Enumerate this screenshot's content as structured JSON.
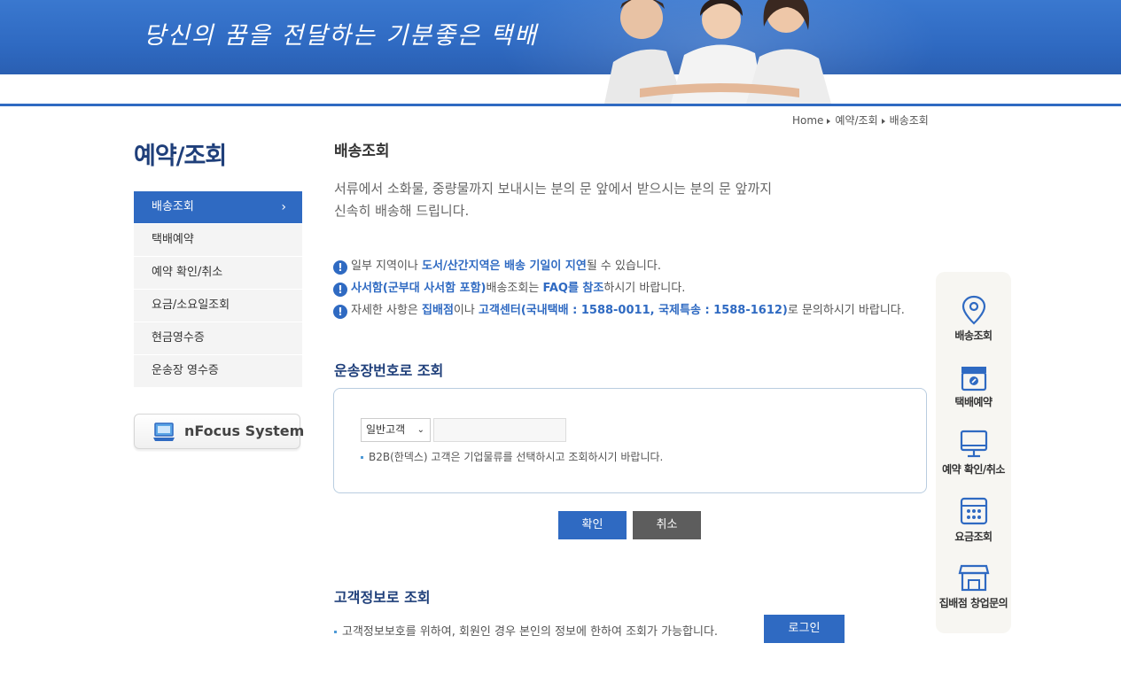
{
  "header": {
    "slogan": "당신의 꿈을 전달하는 기분좋은 택배"
  },
  "breadcrumb": {
    "home": "Home",
    "level1": "예약/조회",
    "level2": "배송조회"
  },
  "sidebar": {
    "title": "예약/조회",
    "items": [
      {
        "label": "배송조회"
      },
      {
        "label": "택배예약"
      },
      {
        "label": "예약 확인/취소"
      },
      {
        "label": "요금/소요일조회"
      },
      {
        "label": "현금영수증"
      },
      {
        "label": "운송장 영수증"
      }
    ],
    "nfocus_label": "nFocus System"
  },
  "main": {
    "title": "배송조회",
    "intro_line1": "서류에서 소화물, 중량물까지 보내시는 분의 문 앞에서 받으시는 분의 문 앞까지",
    "intro_line2": "신속히 배송해 드립니다.",
    "notices": [
      {
        "pre": "일부 지역이나 ",
        "bold": "도서/산간지역은 배송 기일이 지연",
        "post": "될 수 있습니다."
      },
      {
        "bold": "사서함(군부대 사서함 포함)",
        "mid": "배송조회는 ",
        "bold2": "FAQ를 참조",
        "post": "하시기 바랍니다."
      },
      {
        "pre": "자세한 사항은 ",
        "bold": "집배점",
        "mid": "이나 ",
        "bold2": "고객센터(국내택배 : 1588-0011, 국제특송 : 1588-1612)",
        "post": "로 문의하시기 바랍니다."
      }
    ],
    "section1_title": "운송장번호로 조회",
    "customer_type_selected": "일반고객",
    "b2b_note": "B2B(한덱스) 고객은 기업물류를 선택하시고 조회하시기 바랍니다.",
    "confirm_label": "확인",
    "cancel_label": "취소",
    "section2_title": "고객정보로 조회",
    "customer_note": "고객정보보호를 위하여, 회원인 경우 본인의 정보에 한하여 조회가 가능합니다.",
    "login_label": "로그인"
  },
  "quick_menu": {
    "items": [
      {
        "label": "배송조회",
        "icon": "location-pin-icon"
      },
      {
        "label": "택배예약",
        "icon": "parcel-box-icon"
      },
      {
        "label": "예약 확인/취소",
        "icon": "monitor-icon"
      },
      {
        "label": "요금조회",
        "icon": "calculator-icon"
      },
      {
        "label": "집배점 창업문의",
        "icon": "store-icon"
      }
    ]
  },
  "colors": {
    "primary_blue": "#2f6ac2",
    "navy_text": "#1f3f7a",
    "cancel_gray": "#5d5d5d"
  }
}
